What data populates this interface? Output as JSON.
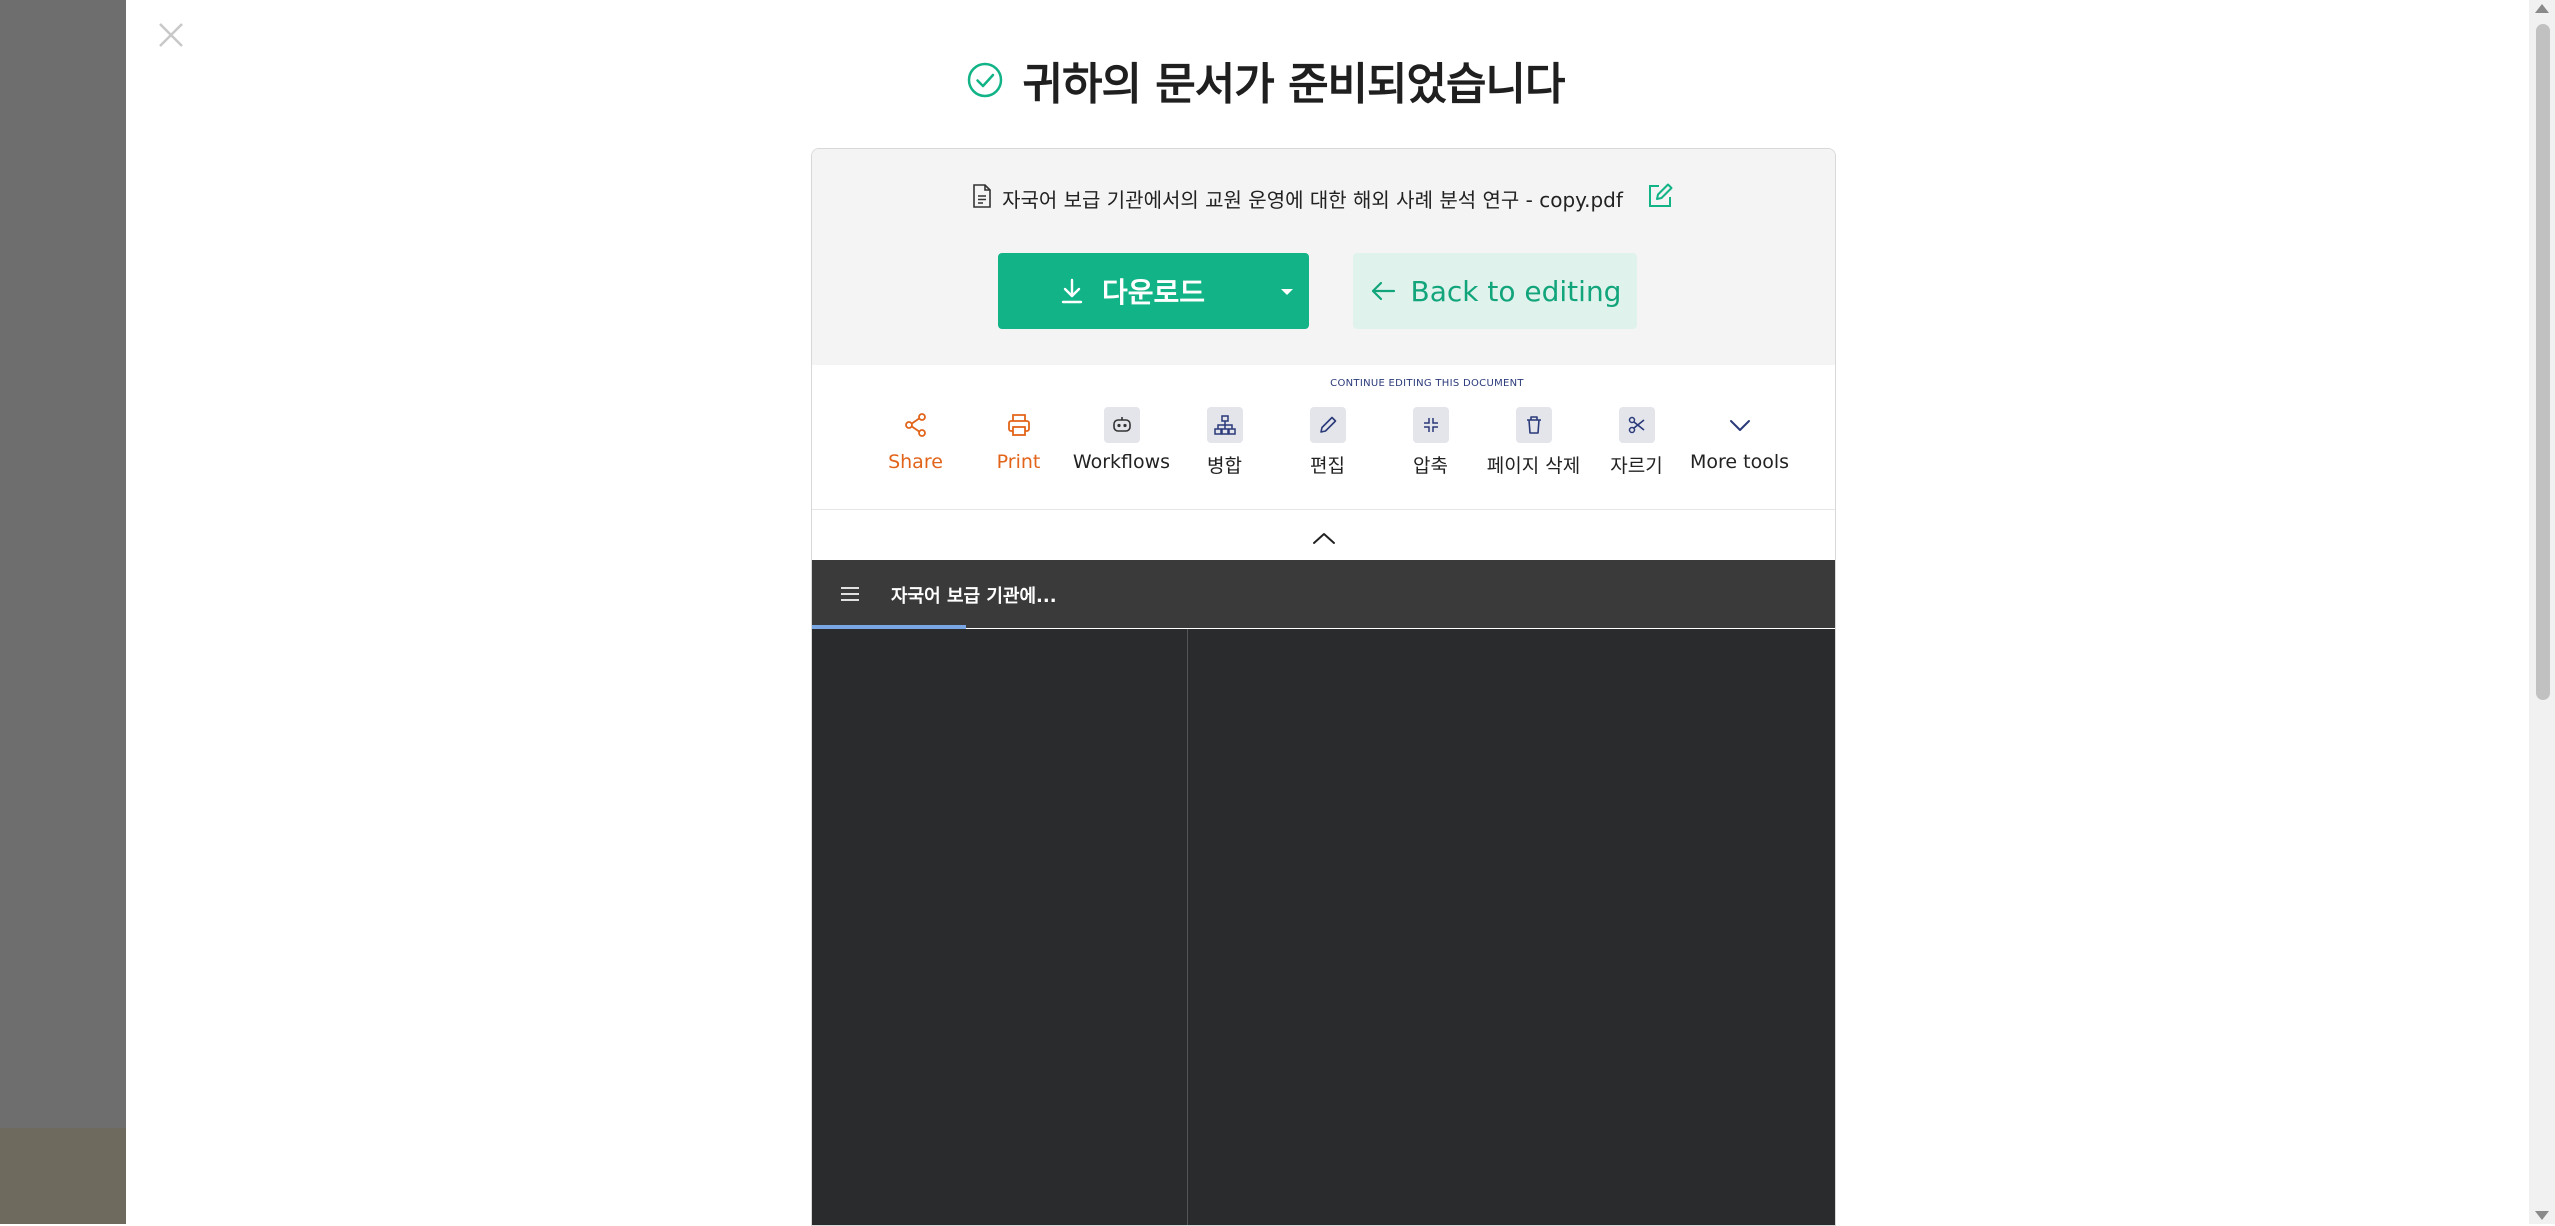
{
  "page": {
    "title": "귀하의 문서가 준비되었습니다",
    "accent_color": "#12b487"
  },
  "file": {
    "name": "자국어 보급 기관에서의 교원 운영에 대한 해외 사례 분석 연구 - copy.pdf"
  },
  "actions": {
    "download_label": "다운로드",
    "back_label": "Back to editing"
  },
  "tools": {
    "section_label": "CONTINUE EDITING THIS DOCUMENT",
    "items": [
      {
        "label": "Share",
        "icon": "share-icon"
      },
      {
        "label": "Print",
        "icon": "print-icon"
      },
      {
        "label": "Workflows",
        "icon": "workflows-icon"
      },
      {
        "label": "병합",
        "icon": "merge-icon"
      },
      {
        "label": "편집",
        "icon": "edit-icon"
      },
      {
        "label": "압축",
        "icon": "compress-icon"
      },
      {
        "label": "페이지 삭제",
        "icon": "delete-page-icon"
      },
      {
        "label": "자르기",
        "icon": "split-icon"
      },
      {
        "label": "More tools",
        "icon": "chevron-down-icon"
      }
    ]
  },
  "viewer": {
    "doc_title": "자국어 보급 기관에..."
  }
}
